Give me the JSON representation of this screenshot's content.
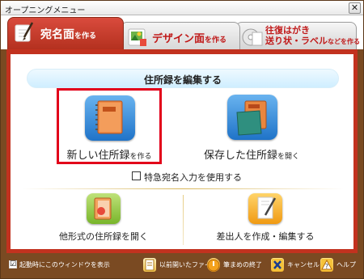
{
  "window": {
    "title": "オープニングメニュー",
    "close_glyph": "✕"
  },
  "tabs": [
    {
      "label": "宛名面",
      "sub": "を作る",
      "active": true
    },
    {
      "label": "デザイン面",
      "sub": "を作る",
      "active": false
    },
    {
      "label_line1": "往復はがき",
      "label_line2": "送り状・ラベル",
      "sub": "などを作る",
      "active": false
    }
  ],
  "main": {
    "section_title": "住所録を編集する",
    "options": {
      "new_address_book": {
        "label": "新しい住所録",
        "sub": "を作る",
        "selected": true
      },
      "saved_address_book": {
        "label": "保存した住所録",
        "sub": "を開く",
        "selected": false
      }
    },
    "express_checkbox": {
      "label": "特急宛名入力を使用する",
      "checked": false
    },
    "other_format": {
      "label": "他形式の住所録を開く"
    },
    "sender": {
      "label": "差出人を作成・編集する"
    }
  },
  "footer": {
    "startup_check_label": "起動時にこのウィンドウを表示",
    "startup_checked": true,
    "check_glyph": "☑",
    "buttons": {
      "previous_file": "以前開いたファイル",
      "exit": "筆まめの終了",
      "cancel": "キャンセル",
      "help": "ヘルプ"
    }
  },
  "colors": {
    "accent": "#c2321f",
    "frame": "#7a4a22",
    "selection": "#e2001a",
    "tab_text": "#c01a1a"
  }
}
